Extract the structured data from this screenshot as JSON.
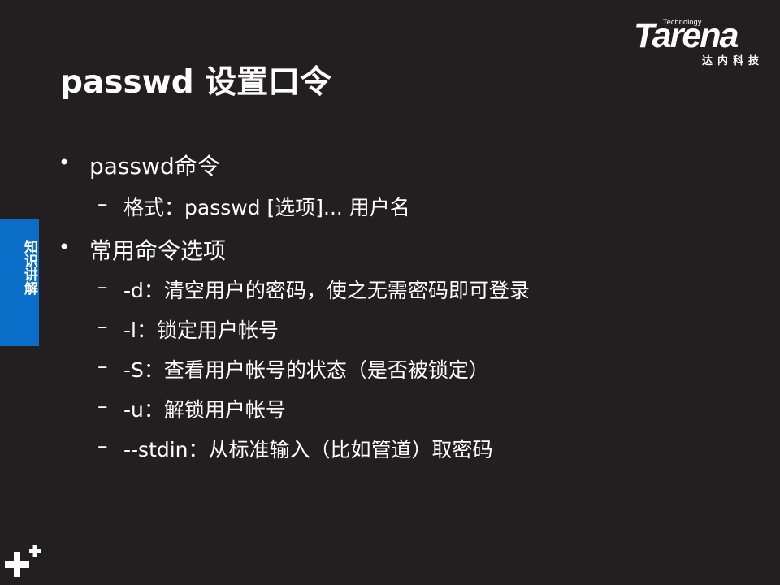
{
  "slide": {
    "title": "passwd 设置口令"
  },
  "logo": {
    "technology": "Technology",
    "word": "Tarena",
    "chinese": "达内科技"
  },
  "side_tab": {
    "label": "知识讲解",
    "color": "#0a6ec8"
  },
  "bullets": [
    {
      "text": "passwd命令",
      "sub": [
        "格式：passwd   [选项]...  用户名"
      ]
    },
    {
      "text": "常用命令选项",
      "sub": [
        "-d：清空用户的密码，使之无需密码即可登录",
        "-l：锁定用户帐号",
        "-S：查看用户帐号的状态（是否被锁定）",
        "-u：解锁用户帐号",
        "--stdin：从标准输入（比如管道）取密码"
      ]
    }
  ],
  "markers": {
    "bullet": "•",
    "dash": "–"
  },
  "colors": {
    "background": "#231f20",
    "text": "#ffffff"
  },
  "icons": {
    "corner_decoration": "plus-icon"
  }
}
